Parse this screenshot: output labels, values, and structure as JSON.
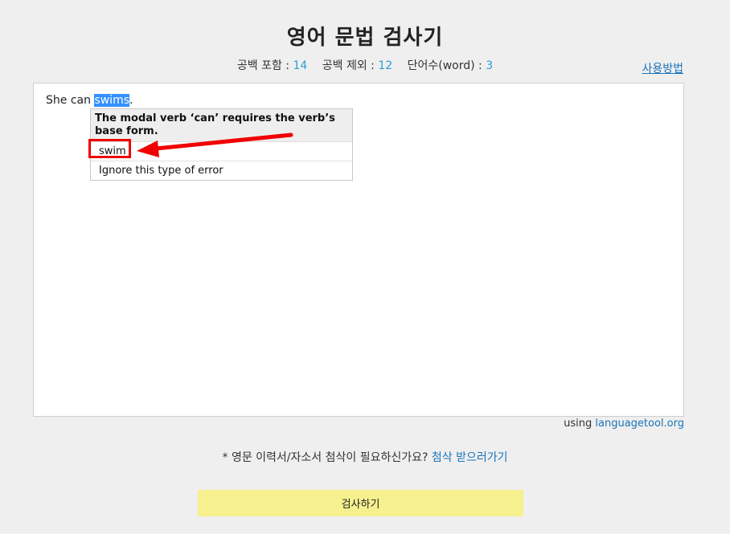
{
  "header": {
    "title": "영어 문법 검사기",
    "usage_link": "사용방법"
  },
  "stats": {
    "with_spaces_label": "공백 포함 :",
    "with_spaces_value": "14",
    "without_spaces_label": "공백 제외 :",
    "without_spaces_value": "12",
    "word_count_label": "단어수(word) :",
    "word_count_value": "3"
  },
  "editor": {
    "text_before": "She can ",
    "highlighted_word": "swims",
    "text_after": "."
  },
  "suggestion_popup": {
    "message": "The modal verb ‘can’ requires the verb’s base form.",
    "options": [
      "swim",
      "Ignore this type of error"
    ]
  },
  "attribution": {
    "prefix": "using",
    "link": "languagetool.org"
  },
  "notice": {
    "text": "* 영문 이력서/자소서 첨삭이 필요하신가요?",
    "link": "첨삭 받으러가기"
  },
  "actions": {
    "check_label": "검사하기"
  },
  "colors": {
    "accent_number": "#2a9fd6",
    "link": "#1a73b8",
    "highlight": "#3390ff",
    "button_bg": "#f6f08e",
    "annotation_red": "#f00000"
  }
}
